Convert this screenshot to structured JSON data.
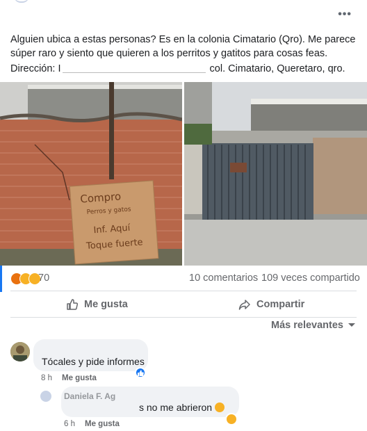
{
  "post": {
    "body": "Alguien ubica a estas personas? Es en la colonia Cimatario (Qro). Me parece súper raro y siento que quieren a los perritos y gatitos para cosas feas.",
    "address_prefix": "Dirección: I",
    "address_suffix": "col. Cimatario, Queretaro, qro."
  },
  "photo_left": {
    "sign_lines": [
      "Compro",
      "Perros y gatos",
      "Inf. Aquí",
      "Toque fuerte"
    ]
  },
  "stats": {
    "reactions_count": "70",
    "comments": "10 comentarios",
    "shares": "109 veces compartido"
  },
  "actions": {
    "like": "Me gusta",
    "share": "Compartir"
  },
  "sort": {
    "label": "Más relevantes"
  },
  "comments": [
    {
      "text": "Tócales y pide informes",
      "time": "8 h",
      "like": "Me gusta"
    },
    {
      "name_fragment": "Daniela F. Ag",
      "text": "s no me abrieron",
      "time": "6 h",
      "like": "Me gusta"
    }
  ],
  "colors": {
    "accent": "#1877f2",
    "muted": "#65676b",
    "bubble": "#f0f2f5"
  }
}
